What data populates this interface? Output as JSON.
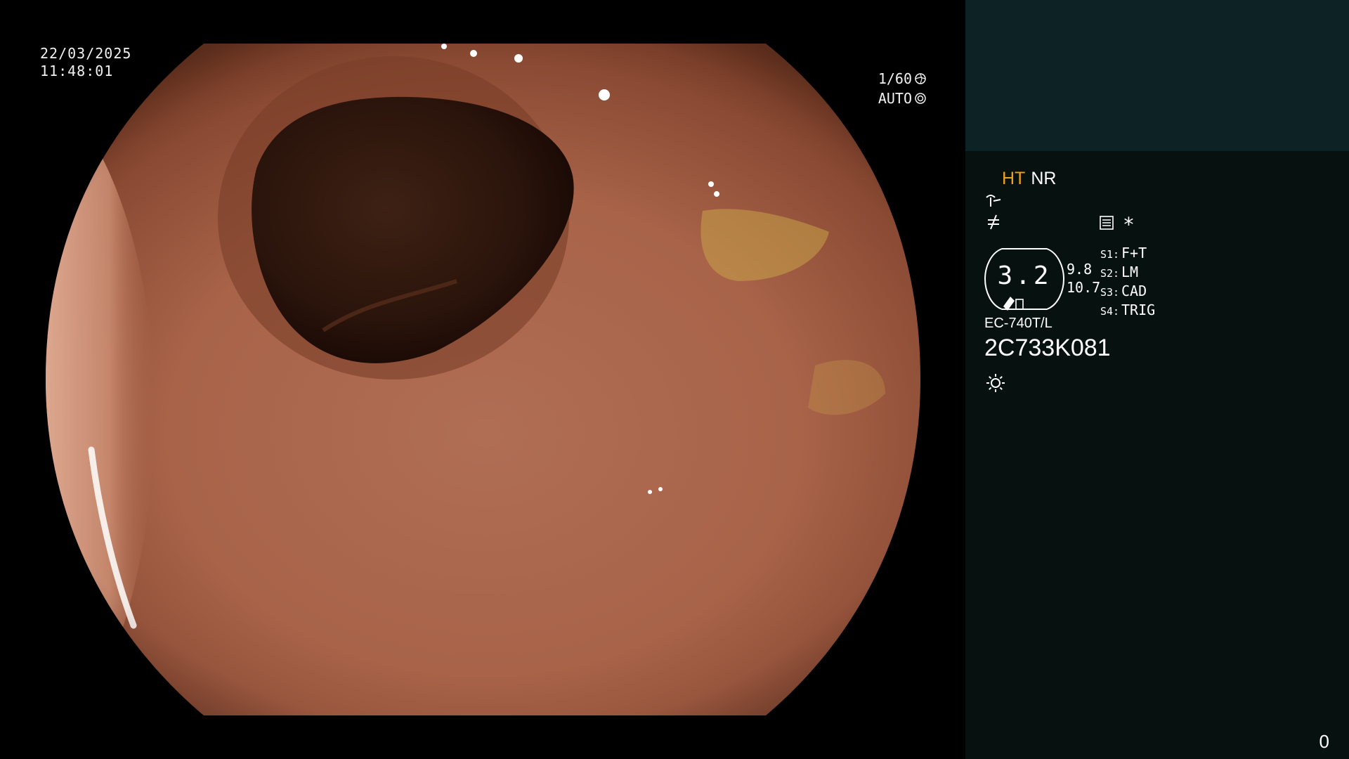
{
  "overlay": {
    "date": "22/03/2025",
    "time": "11:48:01",
    "shutter": "1/60",
    "shutter_icon": "aperture-icon",
    "iris": "AUTO",
    "iris_icon": "iris-icon"
  },
  "panel": {
    "mode_ht": "HT",
    "mode_nr": "NR",
    "enhance_icon": "structure-enhance-icon",
    "color_icon": "color-enhance-icon",
    "menu_icon": "menu-icon",
    "star": "*",
    "zoom": "3.2",
    "ratio_top": "9.8",
    "ratio_bottom": "10.7",
    "switches": [
      {
        "key": "S1:",
        "value": "F+T"
      },
      {
        "key": "S2:",
        "value": "LM"
      },
      {
        "key": "S3:",
        "value": "CAD"
      },
      {
        "key": "S4:",
        "value": "TRIG"
      }
    ],
    "scope_model": "EC-740T/L",
    "scope_serial": "2C733K081",
    "light_icon": "sun-icon",
    "counter": "0",
    "colors": {
      "accent_ht": "#f0a01a",
      "panel_bg": "#071210",
      "panel_top_bg": "#0d2224"
    }
  }
}
